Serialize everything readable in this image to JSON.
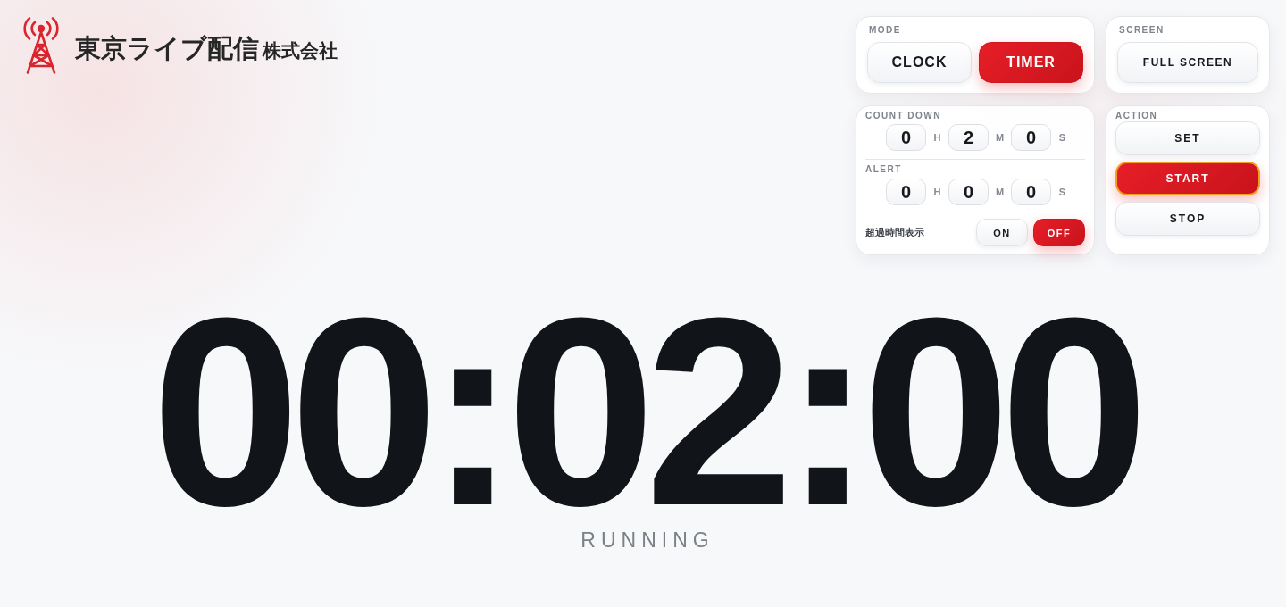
{
  "logo": {
    "name": "東京ライブ配信",
    "suffix": "株式会社"
  },
  "mode": {
    "label": "MODE",
    "options": [
      {
        "label": "CLOCK",
        "selected": false
      },
      {
        "label": "TIMER",
        "selected": true
      }
    ]
  },
  "screen": {
    "label": "SCREEN",
    "button": "FULL SCREEN"
  },
  "countdown": {
    "label": "COUNT DOWN",
    "fields": [
      {
        "value": "0",
        "unit": "H"
      },
      {
        "value": "2",
        "unit": "M"
      },
      {
        "value": "0",
        "unit": "S"
      }
    ]
  },
  "alert": {
    "label": "ALERT",
    "fields": [
      {
        "value": "0",
        "unit": "H"
      },
      {
        "value": "0",
        "unit": "M"
      },
      {
        "value": "0",
        "unit": "S"
      }
    ]
  },
  "overtime": {
    "label": "超過時間表示",
    "options": [
      {
        "label": "ON",
        "selected": false
      },
      {
        "label": "OFF",
        "selected": true
      }
    ]
  },
  "action": {
    "label": "ACTION",
    "buttons": [
      {
        "label": "SET",
        "selected": false,
        "focused": false
      },
      {
        "label": "START",
        "selected": true,
        "focused": true
      },
      {
        "label": "STOP",
        "selected": false,
        "focused": false
      }
    ]
  },
  "display": {
    "time": "00:02:00",
    "status": "RUNNING"
  }
}
